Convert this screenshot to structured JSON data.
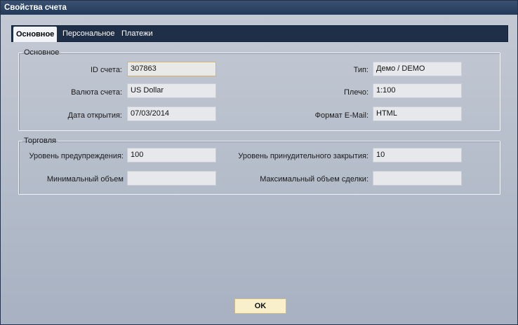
{
  "window": {
    "title": "Свойства счета"
  },
  "tabs": [
    {
      "label": "Основное"
    },
    {
      "label": "Персональное"
    },
    {
      "label": "Платежи"
    }
  ],
  "general": {
    "legend": "Основное",
    "account_id": {
      "label": "ID счета:",
      "value": "307863"
    },
    "currency": {
      "label": "Валюта счета:",
      "value": "US Dollar"
    },
    "open_date": {
      "label": "Дата открытия:",
      "value": "07/03/2014"
    },
    "type": {
      "label": "Тип:",
      "value": "Демо / DEMO"
    },
    "leverage": {
      "label": "Плечо:",
      "value": "1:100"
    },
    "email_format": {
      "label": "Формат E-Mail:",
      "value": "HTML"
    }
  },
  "trading": {
    "legend": "Торговля",
    "warning_level": {
      "label": "Уровень предупреждения:",
      "value": "100"
    },
    "stopout_level": {
      "label": "Уровень принудительного закрытия:",
      "value": "10"
    },
    "min_volume": {
      "label": "Минимальный объем",
      "value": ""
    },
    "max_volume": {
      "label": "Максимальный объем сделки:",
      "value": ""
    }
  },
  "buttons": {
    "ok": "OK"
  }
}
